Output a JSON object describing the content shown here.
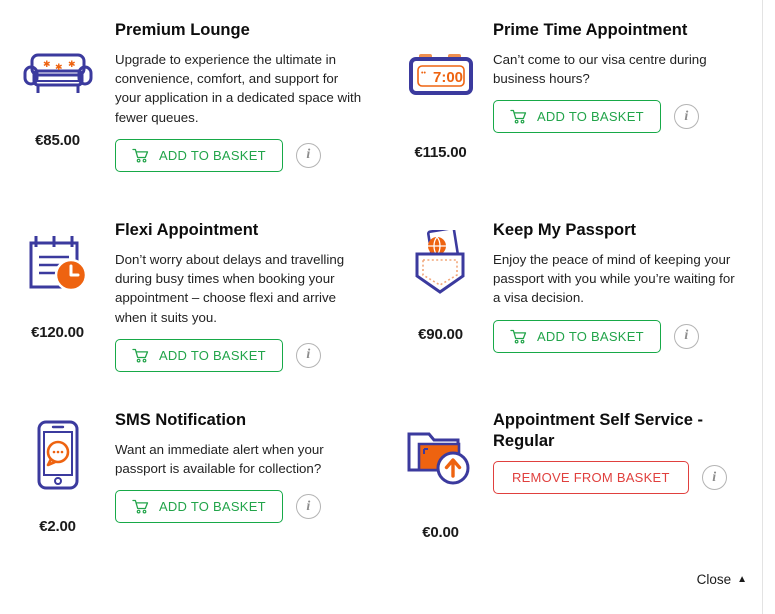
{
  "colors": {
    "icon_navy": "#3b3a9e",
    "icon_orange": "#ee6310",
    "add_green": "#22a44a",
    "remove_red": "#e0403e",
    "info_gray": "#8c8c8c",
    "divider": "#e3e3e3",
    "background": "#ffffff"
  },
  "labels": {
    "add_to_basket": "ADD TO BASKET",
    "remove_from_basket": "REMOVE FROM BASKET",
    "info": "i",
    "cart_icon": "shopping-cart-icon",
    "close": "Close",
    "close_caret": "▲"
  },
  "products": [
    {
      "id": "premium-lounge",
      "icon": "sofa-icon",
      "price": "€85.00",
      "title": "Premium Lounge",
      "description": "Upgrade to experience the ultimate in convenience, comfort, and support for your application in a dedicated space with fewer queues.",
      "action": "ADD TO BASKET",
      "in_basket": false
    },
    {
      "id": "prime-time-appointment",
      "icon": "alarm-clock-icon",
      "price": "€115.00",
      "title": "Prime Time Appointment",
      "description": "Can’t come to our visa centre during business hours?",
      "action": "ADD TO BASKET",
      "in_basket": false
    },
    {
      "id": "flexi-appointment",
      "icon": "calendar-clock-icon",
      "price": "€120.00",
      "title": "Flexi Appointment",
      "description": "Don’t worry about delays and travelling during busy times when booking your appointment – choose flexi and arrive when it suits you.",
      "action": "ADD TO BASKET",
      "in_basket": false
    },
    {
      "id": "keep-my-passport",
      "icon": "passport-pocket-icon",
      "price": "€90.00",
      "title": "Keep My Passport",
      "description": "Enjoy the peace of mind of keeping your passport with you while you’re waiting for a visa decision.",
      "action": "ADD TO BASKET",
      "in_basket": false
    },
    {
      "id": "sms-notification",
      "icon": "mobile-message-icon",
      "price": "€2.00",
      "title": "SMS Notification",
      "description": "Want an immediate alert when your passport is available for collection?",
      "action": "ADD TO BASKET",
      "in_basket": false
    },
    {
      "id": "appointment-self-service-regular",
      "icon": "folder-upload-icon",
      "price": "€0.00",
      "title": "Appointment Self Service - Regular",
      "description": "",
      "action": "REMOVE FROM BASKET",
      "in_basket": true
    }
  ]
}
